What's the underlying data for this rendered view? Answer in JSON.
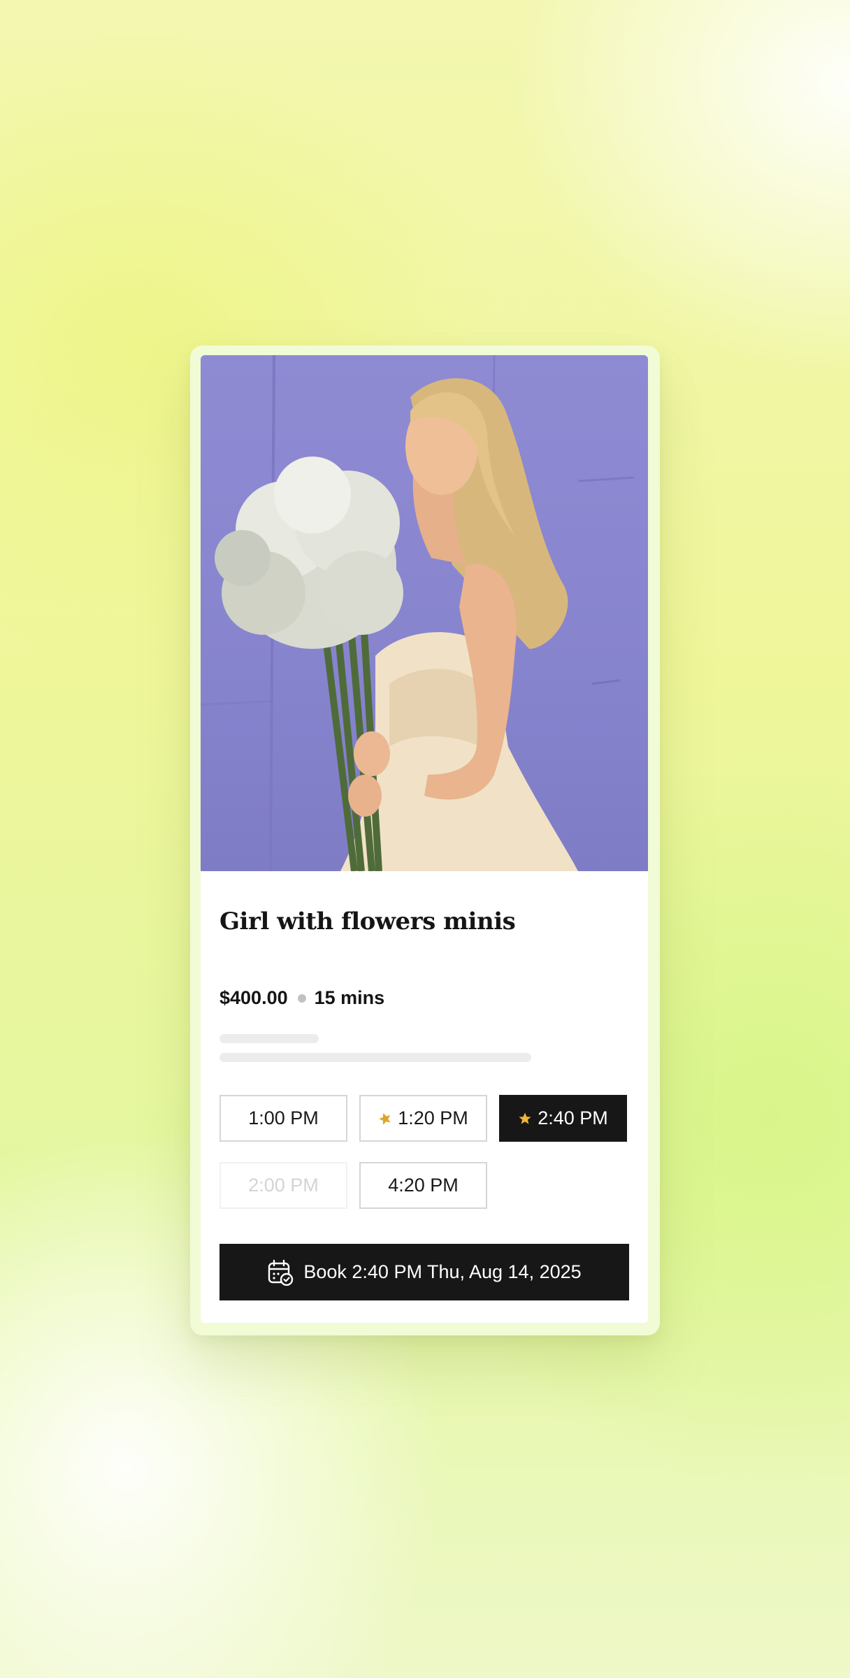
{
  "service": {
    "title": "Girl with flowers minis",
    "price": "$400.00",
    "duration": "15 mins",
    "image_alt": "Woman in a cream gown holding a bouquet of white baby's breath against a lavender wall"
  },
  "time_slots": [
    {
      "label": "1:00 PM",
      "state": "available",
      "starred": false
    },
    {
      "label": "1:20 PM",
      "state": "available",
      "starred": true
    },
    {
      "label": "2:40 PM",
      "state": "selected",
      "starred": true
    },
    {
      "label": "2:00 PM",
      "state": "disabled",
      "starred": false
    },
    {
      "label": "4:20 PM",
      "state": "available",
      "starred": false
    }
  ],
  "book_button": {
    "label": "Book 2:40 PM Thu, Aug 14, 2025",
    "icon": "calendar-check-icon"
  },
  "colors": {
    "accent": "#171717",
    "photo_background": "#8784ce",
    "star": "#e0a42a"
  }
}
